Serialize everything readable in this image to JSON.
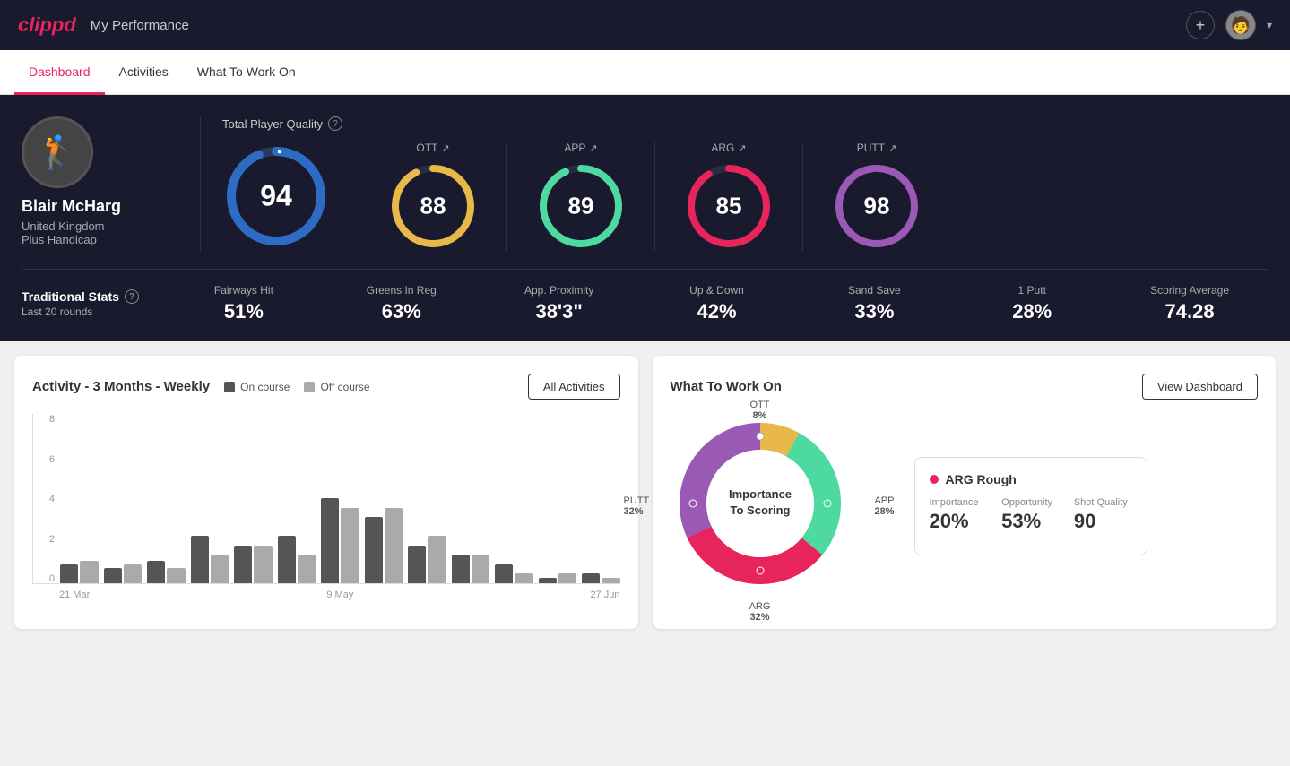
{
  "app": {
    "logo": "clippd",
    "header_title": "My Performance",
    "add_icon": "+",
    "avatar_icon": "👤"
  },
  "nav": {
    "tabs": [
      {
        "id": "dashboard",
        "label": "Dashboard",
        "active": true
      },
      {
        "id": "activities",
        "label": "Activities",
        "active": false
      },
      {
        "id": "what-to-work-on",
        "label": "What To Work On",
        "active": false
      }
    ]
  },
  "player": {
    "name": "Blair McHarg",
    "country": "United Kingdom",
    "handicap": "Plus Handicap",
    "avatar": "🏌️"
  },
  "total_quality": {
    "label": "Total Player Quality",
    "value": 94
  },
  "scores": [
    {
      "id": "ott",
      "label": "OTT",
      "value": 88,
      "color": "#e8b84b",
      "trail": "#333",
      "trend": "↗"
    },
    {
      "id": "app",
      "label": "APP",
      "value": 89,
      "color": "#4dd9a0",
      "trail": "#333",
      "trend": "↗"
    },
    {
      "id": "arg",
      "label": "ARG",
      "value": 85,
      "color": "#e8245c",
      "trail": "#333",
      "trend": "↗"
    },
    {
      "id": "putt",
      "label": "PUTT",
      "value": 98,
      "color": "#9b59b6",
      "trail": "#333",
      "trend": "↗"
    }
  ],
  "traditional_stats": {
    "label": "Traditional Stats",
    "sublabel": "Last 20 rounds",
    "stats": [
      {
        "name": "Fairways Hit",
        "value": "51%"
      },
      {
        "name": "Greens In Reg",
        "value": "63%"
      },
      {
        "name": "App. Proximity",
        "value": "38'3\""
      },
      {
        "name": "Up & Down",
        "value": "42%"
      },
      {
        "name": "Sand Save",
        "value": "33%"
      },
      {
        "name": "1 Putt",
        "value": "28%"
      },
      {
        "name": "Scoring Average",
        "value": "74.28"
      }
    ]
  },
  "activity_chart": {
    "title": "Activity - 3 Months - Weekly",
    "legend": {
      "on_course_label": "On course",
      "off_course_label": "Off course"
    },
    "all_activities_btn": "All Activities",
    "x_labels": [
      "21 Mar",
      "9 May",
      "27 Jun"
    ],
    "y_labels": [
      "0",
      "2",
      "4",
      "6",
      "8"
    ],
    "bars": [
      {
        "on": 1,
        "off": 1.2
      },
      {
        "on": 0.8,
        "off": 1
      },
      {
        "on": 1.2,
        "off": 0.8
      },
      {
        "on": 2.5,
        "off": 1.5
      },
      {
        "on": 2,
        "off": 2
      },
      {
        "on": 2.5,
        "off": 1.5
      },
      {
        "on": 4.5,
        "off": 4
      },
      {
        "on": 3.5,
        "off": 4
      },
      {
        "on": 2,
        "off": 2.5
      },
      {
        "on": 1.5,
        "off": 1.5
      },
      {
        "on": 1,
        "off": 0.5
      },
      {
        "on": 0.3,
        "off": 0.5
      },
      {
        "on": 0.5,
        "off": 0.3
      }
    ]
  },
  "what_to_work": {
    "title": "What To Work On",
    "view_dashboard_btn": "View Dashboard",
    "donut": {
      "center_label_line1": "Importance",
      "center_label_line2": "To Scoring",
      "segments": [
        {
          "label": "OTT",
          "percent": "8%",
          "color": "#e8b84b"
        },
        {
          "label": "APP",
          "percent": "28%",
          "color": "#4dd9a0"
        },
        {
          "label": "ARG",
          "percent": "32%",
          "color": "#e8245c"
        },
        {
          "label": "PUTT",
          "percent": "32%",
          "color": "#9b59b6"
        }
      ]
    },
    "info_card": {
      "title": "ARG Rough",
      "metrics": [
        {
          "name": "Importance",
          "value": "20%",
          "fill": 20
        },
        {
          "name": "Opportunity",
          "value": "53%",
          "fill": 53
        },
        {
          "name": "Shot Quality",
          "value": "90",
          "fill": 90
        }
      ]
    }
  }
}
